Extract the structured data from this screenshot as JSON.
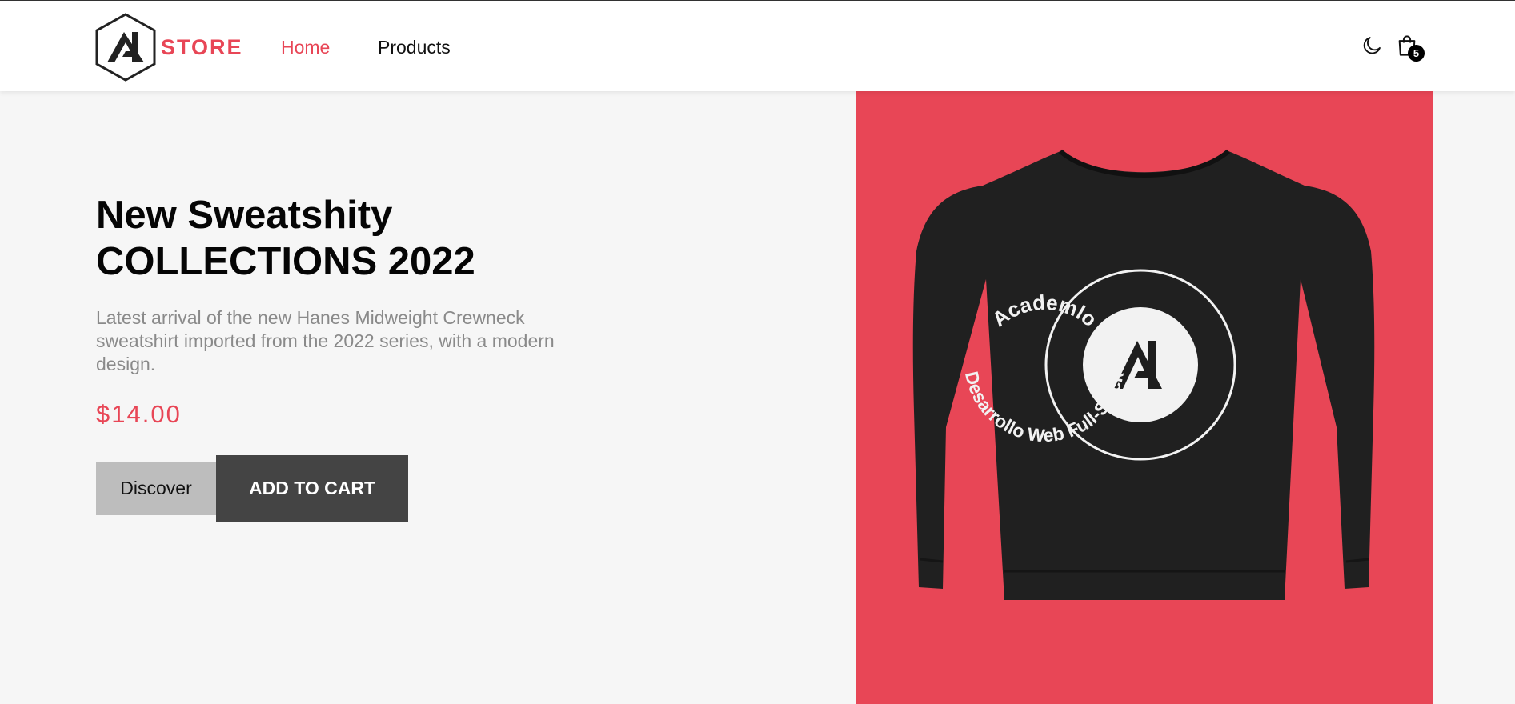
{
  "header": {
    "brand": "STORE",
    "nav": {
      "home": "Home",
      "products": "Products"
    },
    "cart_count": "5",
    "icons": {
      "logo": "academlo-hexagon-logo",
      "theme": "moon-icon",
      "cart": "shopping-bag-icon"
    }
  },
  "hero": {
    "title_line1": "New Sweatshity",
    "title_line2": "COLLECTIONS 2022",
    "description": "Latest arrival of the new Hanes Midweight Crewneck sweatshirt imported from the 2022 series, with a modern design.",
    "price": "$14.00",
    "discover_label": "Discover",
    "add_to_cart_label": "ADD TO CART"
  },
  "product_image": {
    "print_top_text": "Academlo",
    "print_bottom_text": "Desarrollo Web Full-Stack"
  },
  "colors": {
    "accent": "#e84656",
    "panel": "#e84656",
    "page_bg": "#f6f6f6",
    "primary_button": "#444444",
    "secondary_button": "#bdbdbd"
  }
}
